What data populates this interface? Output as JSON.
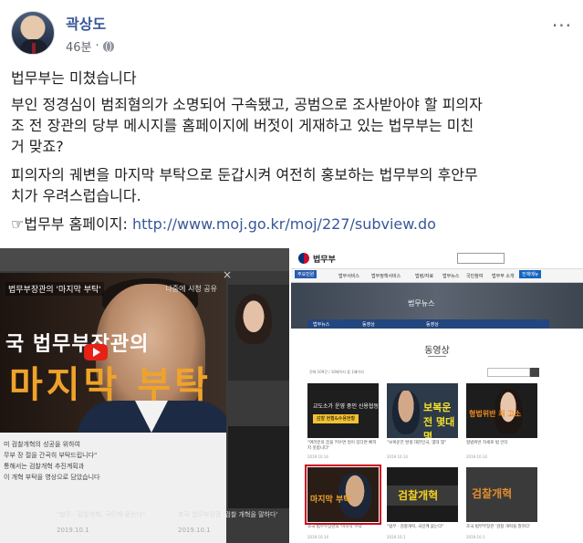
{
  "post": {
    "author": "곽상도",
    "time": "46분",
    "privacy_icon": "globe-icon",
    "more_icon": "more-options-icon",
    "more_label": "···",
    "paragraph1": "법무부는 미쳤습니다",
    "paragraph2_line1": "부인 정경심이 범죄혐의가 소명되어 구속됐고, 공범으로 조사받아야 할 피의자",
    "paragraph2_line2": "조 전 장관의 당부 메시지를 홈페이지에 버젓이 게재하고 있는 법무부는 미친",
    "paragraph2_line3": "거 맞죠?",
    "paragraph3_line1": "피의자의 궤변을 마지막 부탁으로 둔갑시켜 여전히 홍보하는 법무부의 후안무",
    "paragraph3_line2": "치가 우려스럽습니다.",
    "link_prefix": "☞법무부 홈페이지: ",
    "link_url": "http://www.moj.go.kr/moj/227/subview.do"
  },
  "left_image": {
    "video_overlay_small": "법무부장관의 '마지막 부탁'",
    "video_title_line1": "국 법무부장관의",
    "video_title_line2": "마지막 부탁",
    "share_text": "나중에 시청  공유",
    "close_label": "×",
    "modal_line1": "미 검찰개혁의 성공을 위하여",
    "modal_line2": "무부 장 절을 간곡히 부탁드립니다\"",
    "modal_line3": "통해서는 검찰개혁 추진계획과",
    "modal_line4": "이 개혁 부탁을 영상으로 담았습니다",
    "cap1": "\"법무 · 검찰개혁, 국민께 묻는다\"",
    "cap2": "조국 법무부장관 '검찰 개혁을 말하다'",
    "meta1": "2019.10.1",
    "meta2": "2019.10.1"
  },
  "right_image": {
    "brand": "법무부",
    "nav": [
      "주요민원",
      "법무서비스",
      "법무정책서비스",
      "법령/자료",
      "법무뉴스",
      "국민참여",
      "법무부 소개",
      "전체메뉴"
    ],
    "banner_text": "법무뉴스",
    "crumbs": [
      "법무뉴스",
      "동영상",
      "",
      "동영상"
    ],
    "heading": "동영상",
    "filter_text": "전체 109건 / 10페이지 중 1페이지",
    "thumbs": [
      {
        "label": "교도소가 운영 중인 신용협동",
        "box": "감찰 현황&수용현황",
        "caption": "\"여러분의 꿈을 키우면 일이 있다면 빠지지 못합니다\"",
        "meta": "2019.10.14"
      },
      {
        "big": "보복운전 몇대 몇",
        "caption": "\"보복운전 발생 대한민국, 몇대 몇\"",
        "meta": "2019.10.14"
      },
      {
        "txt": "형법위반 죄 고소",
        "caption": "형법위반 자세로 법 안다",
        "meta": "2019.10.14"
      },
      {
        "txt": "마지막 부탁",
        "caption": "조국 법무부장관의 '마지막 부탁'",
        "meta": "2019.10.14"
      },
      {
        "txt": "검찰개혁",
        "caption": "\"법무 · 검찰개혁, 국민께 묻는다\"",
        "meta": "2019.10.1"
      },
      {
        "txt": "검찰개혁",
        "caption": "조국 법무부장관 '검찰 개혁을 말하다'",
        "meta": "2019.10.1"
      }
    ]
  }
}
